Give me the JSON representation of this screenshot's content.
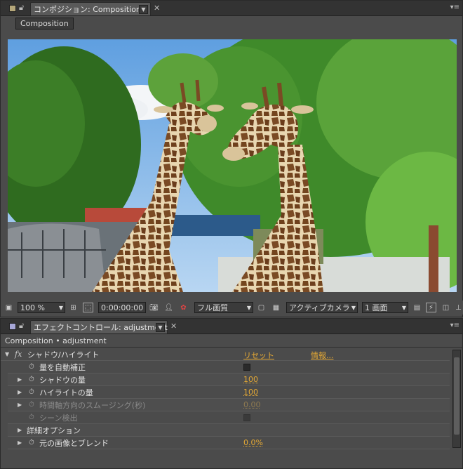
{
  "comp_panel": {
    "tab_label": "コンポジション: Composition",
    "sub_button": "Composition",
    "panel_menu_glyph": "▾≡"
  },
  "viewer": {
    "description_icon": "giraffe-photo"
  },
  "footer": {
    "zoom": "100 %",
    "timecode": "0:00:00:00",
    "resolution": "フル画質",
    "camera": "アクティブカメラ",
    "views": "1 画面"
  },
  "effects_panel": {
    "tab_label": "エフェクトコントロール: adjustment",
    "breadcrumb": "Composition • adjustment",
    "effect": {
      "fx_glyph": "fx",
      "name": "シャドウ/ハイライト",
      "reset": "リセット",
      "about": "情報..."
    },
    "properties": [
      {
        "label": "量を自動補正",
        "kind": "checkbox",
        "value": "",
        "dim": false,
        "has_triangle": false
      },
      {
        "label": "シャドウの量",
        "kind": "value",
        "value": "100",
        "dim": false,
        "has_triangle": true
      },
      {
        "label": "ハイライトの量",
        "kind": "value",
        "value": "100",
        "dim": false,
        "has_triangle": true
      },
      {
        "label": "時間軸方向のスムージング(秒)",
        "kind": "value",
        "value": "0.00",
        "dim": true,
        "has_triangle": true
      },
      {
        "label": "シーン検出",
        "kind": "checkbox",
        "value": "",
        "dim": true,
        "has_triangle": false
      },
      {
        "label": "詳細オプション",
        "kind": "group",
        "value": "",
        "dim": false,
        "has_triangle": true
      },
      {
        "label": "元の画像とブレンド",
        "kind": "value",
        "value": "0.0%",
        "dim": false,
        "has_triangle": true
      }
    ]
  },
  "colors": {
    "accent_value": "#e5a935",
    "comp_swatch": "#b5a77a",
    "effects_swatch": "#a7a7d8"
  }
}
